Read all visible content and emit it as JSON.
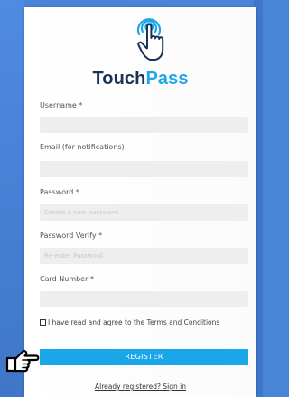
{
  "brand": {
    "name_part1": "Touch",
    "name_part2": "Pass",
    "color_dark": "#1a3355",
    "color_accent": "#20a6e6",
    "logo_icon": "tap-finger-icon"
  },
  "form": {
    "username": {
      "label": "Username *",
      "value": "",
      "placeholder": ""
    },
    "email": {
      "label": "Email (for notifications)",
      "value": "",
      "placeholder": ""
    },
    "password": {
      "label": "Password *",
      "value": "",
      "placeholder": "Create a new password"
    },
    "password_verify": {
      "label": "Password Verify *",
      "value": "",
      "placeholder": "Re-enter Password"
    },
    "card_number": {
      "label": "Card Number *",
      "value": "",
      "placeholder": ""
    },
    "terms": {
      "label": "I have read and agree to the Terms and Conditions",
      "checked": false
    },
    "register_label": "REGISTER",
    "signin_link": "Already registered? Sign in"
  },
  "pointer": {
    "icon": "pointing-hand-icon"
  }
}
